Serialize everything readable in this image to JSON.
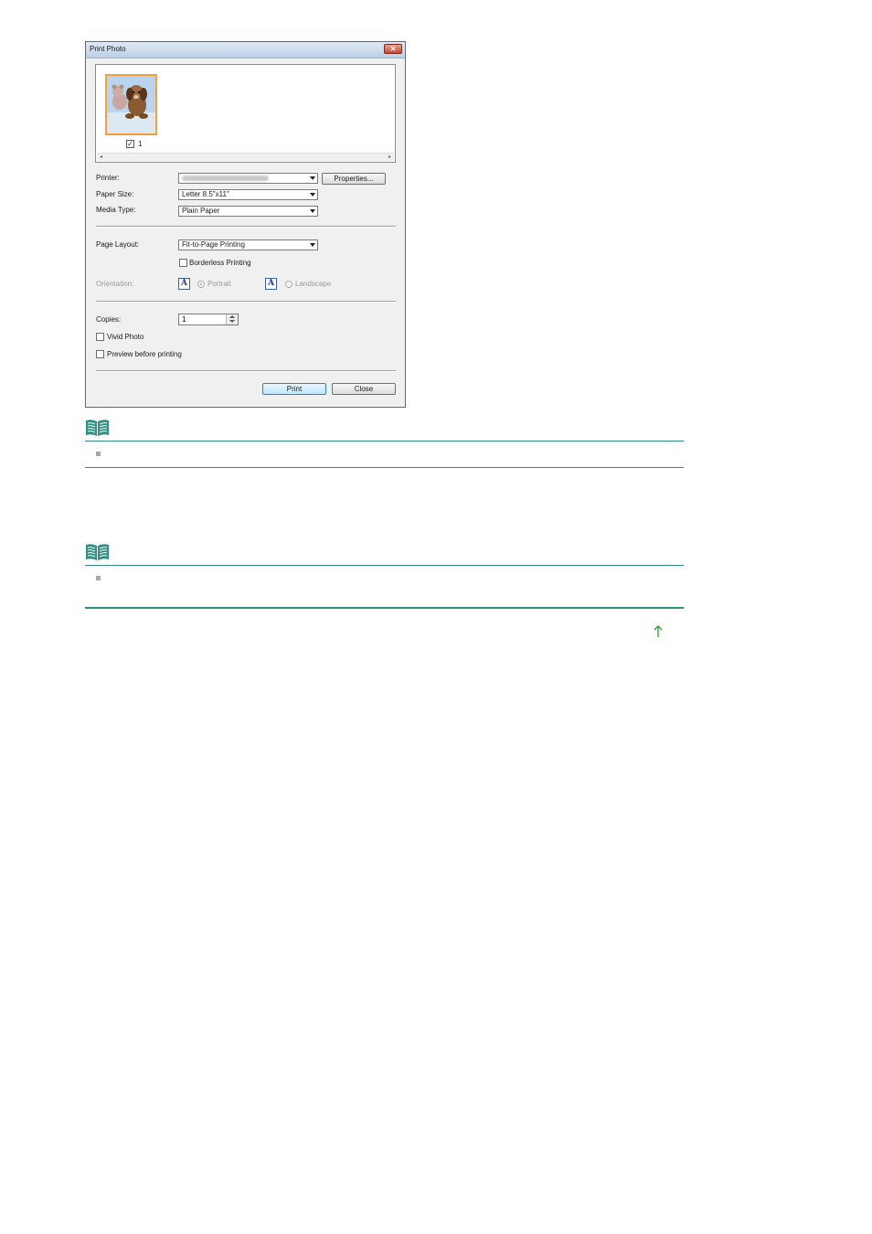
{
  "dialog": {
    "title": "Print Photo",
    "thumbnail": {
      "number": "1",
      "checked": true
    },
    "printer": {
      "label": "Printer:",
      "value_blurred": true,
      "properties_button": "Properties..."
    },
    "paper_size": {
      "label": "Paper Size:",
      "value": "Letter 8.5\"x11\""
    },
    "media_type": {
      "label": "Media Type:",
      "value": "Plain Paper"
    },
    "page_layout": {
      "label": "Page Layout:",
      "value": "Fit-to-Page Printing"
    },
    "borderless": {
      "label": "Borderless Printing",
      "checked": false
    },
    "orientation": {
      "label": "Orientation:",
      "portrait": "Portrait",
      "landscape": "Landscape",
      "icon_letter": "A",
      "selected": "Portrait",
      "disabled": true
    },
    "copies": {
      "label": "Copies:",
      "value": "1"
    },
    "vivid_photo": {
      "label": "Vivid Photo",
      "checked": false
    },
    "preview_before_printing": {
      "label": "Preview before printing",
      "checked": false
    },
    "buttons": {
      "print": "Print",
      "close": "Close"
    }
  },
  "colors": {
    "rule": "#2f8f80",
    "note_icon": "#2f8f80",
    "thumbnail_border": "#f2a23a"
  }
}
